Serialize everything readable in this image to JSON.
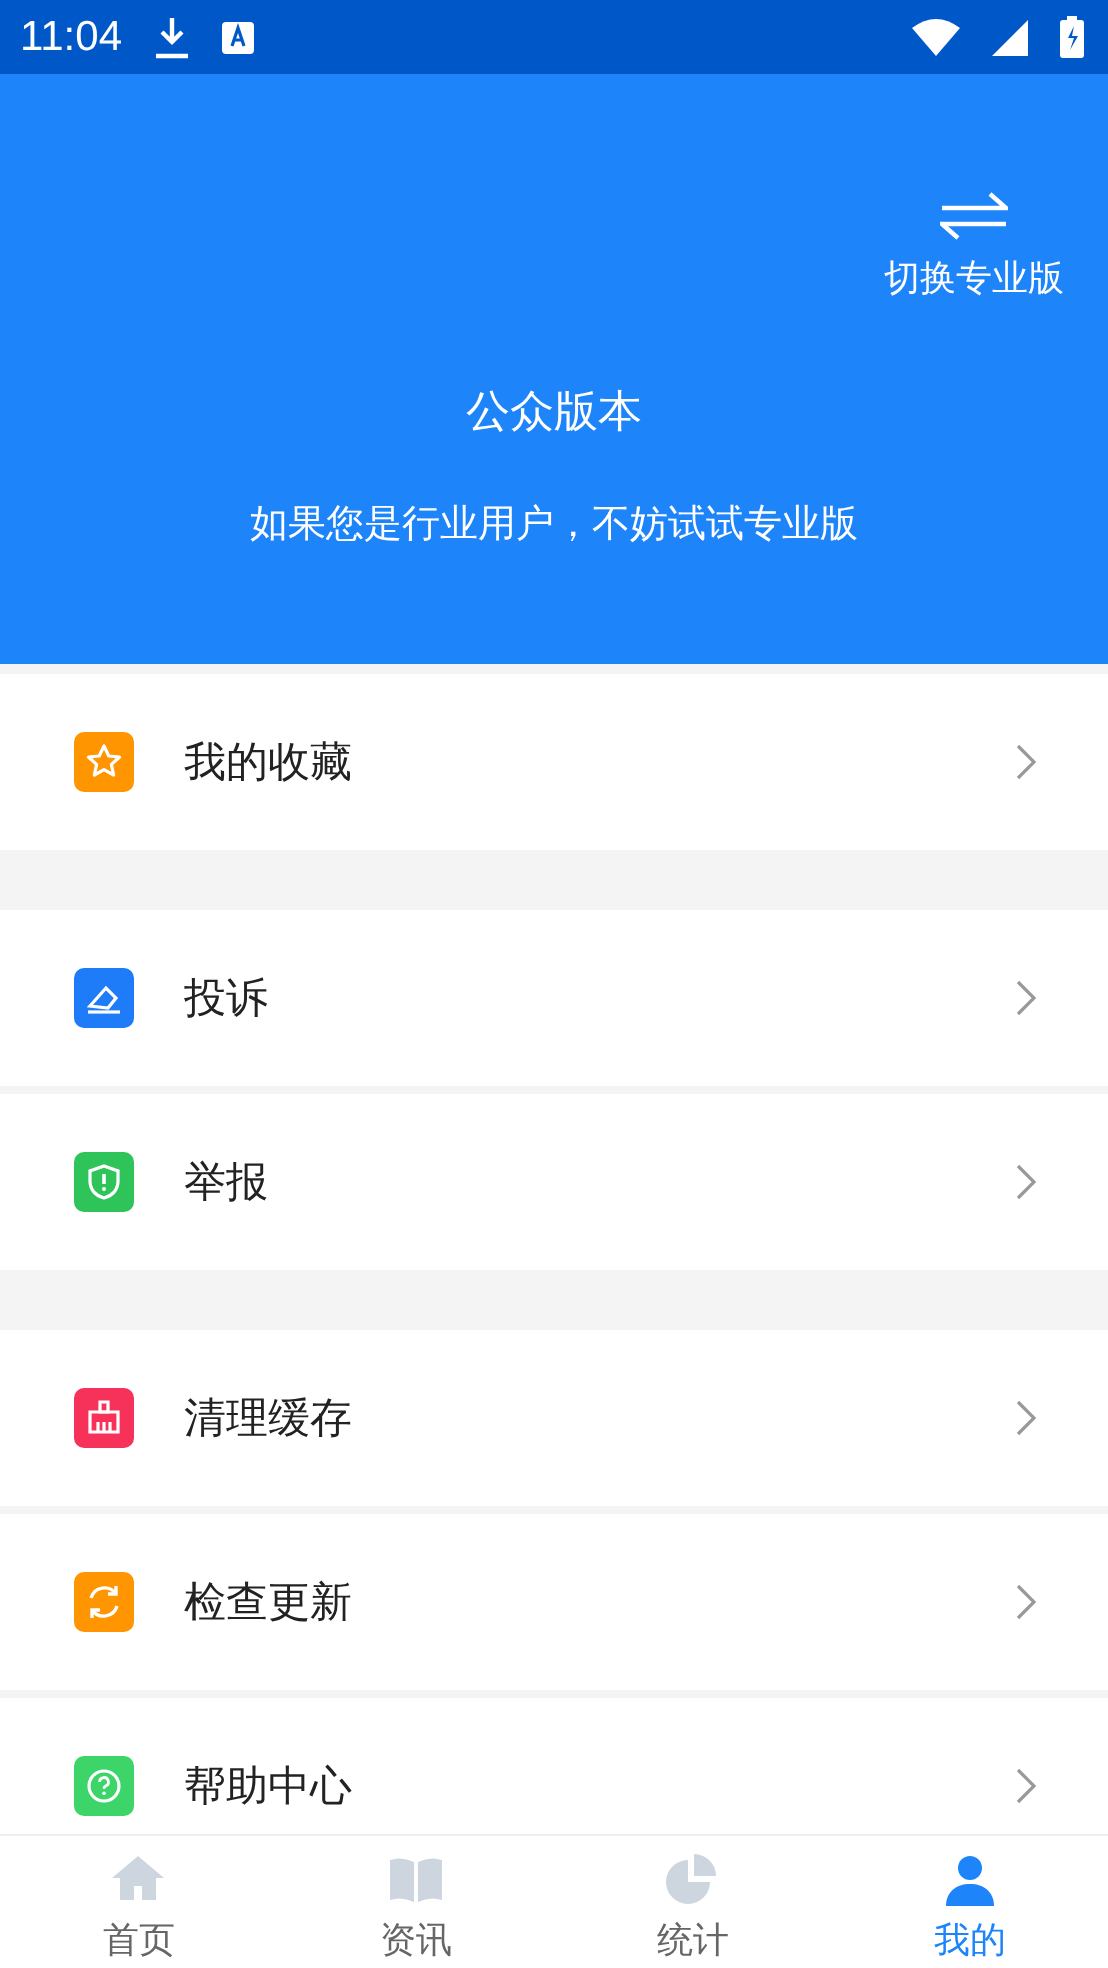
{
  "status_bar": {
    "time": "11:04"
  },
  "header": {
    "switch_label": "切换专业版",
    "title": "公众版本",
    "subtitle": "如果您是行业用户，不妨试试专业版"
  },
  "sections": [
    {
      "items": [
        {
          "kind": "star",
          "label": "我的收藏",
          "color": "#ff9500"
        }
      ]
    },
    {
      "items": [
        {
          "kind": "pen",
          "label": "投诉",
          "color": "#1e7cf8"
        },
        {
          "kind": "shield",
          "label": "举报",
          "color": "#2fc45a"
        }
      ]
    },
    {
      "items": [
        {
          "kind": "broom",
          "label": "清理缓存",
          "color": "#f7325a"
        },
        {
          "kind": "refresh",
          "label": "检查更新",
          "color": "#ff9500"
        },
        {
          "kind": "help",
          "label": "帮助中心",
          "color": "#3dd46a"
        }
      ]
    }
  ],
  "tabs": [
    {
      "kind": "home",
      "label": "首页",
      "selected": false
    },
    {
      "kind": "book",
      "label": "资讯",
      "selected": false
    },
    {
      "kind": "pie",
      "label": "统计",
      "selected": false
    },
    {
      "kind": "person",
      "label": "我的",
      "selected": true
    }
  ]
}
